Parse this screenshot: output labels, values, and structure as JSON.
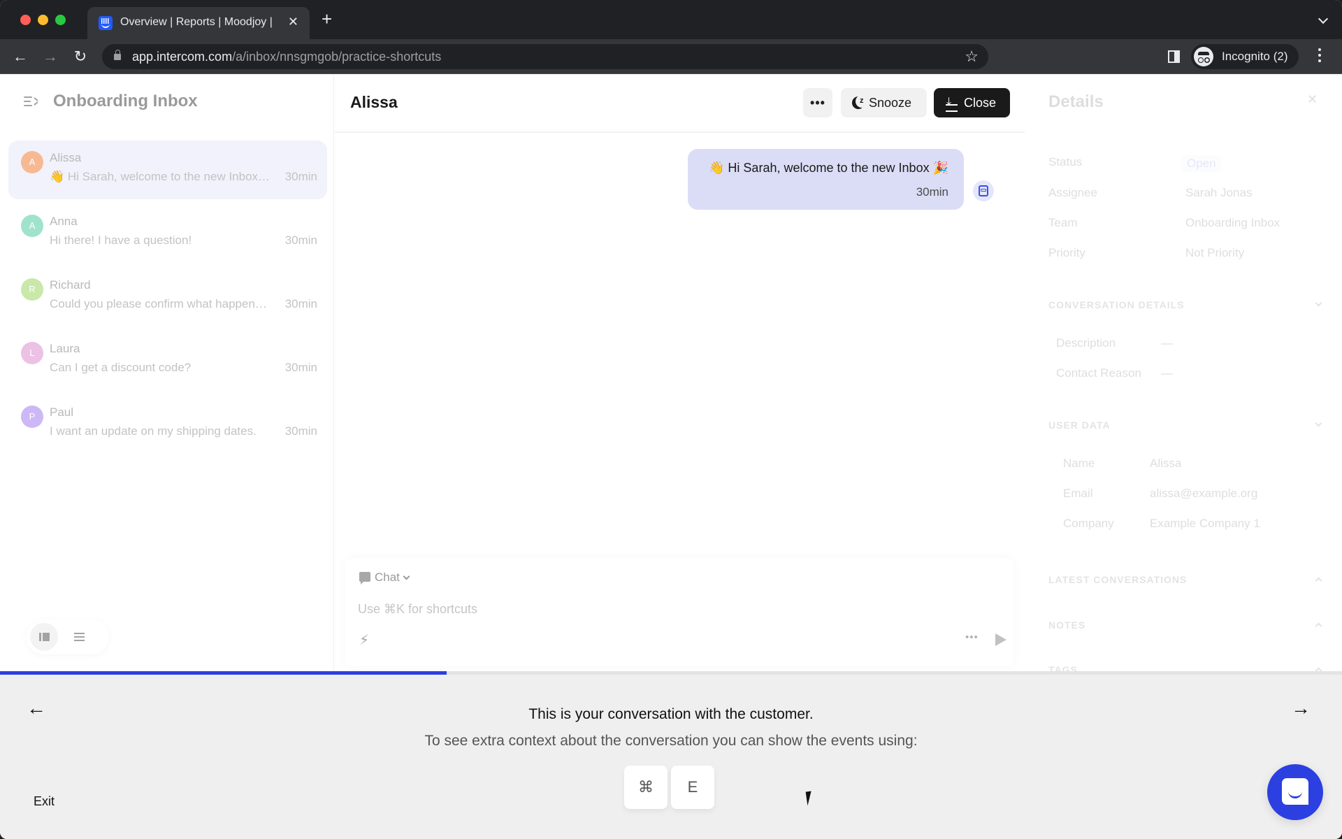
{
  "browser": {
    "tab_title": "Overview | Reports | Moodjoy |",
    "url_host": "app.intercom.com",
    "url_path": "/a/inbox/nnsgmgob/practice-shortcuts",
    "profile_label": "Incognito (2)"
  },
  "inbox": {
    "title": "Onboarding Inbox",
    "conversations": [
      {
        "initial": "A",
        "name": "Alissa",
        "preview": "👋 Hi Sarah, welcome to the new Inbox 🎉",
        "time": "30min",
        "color": "#f7b993",
        "selected": true
      },
      {
        "initial": "A",
        "name": "Anna",
        "preview": "Hi there! I have a question!",
        "time": "30min",
        "color": "#9fe3cc",
        "selected": false
      },
      {
        "initial": "R",
        "name": "Richard",
        "preview": "Could you please confirm what happened with my order?",
        "time": "30min",
        "color": "#c9e8a9",
        "selected": false
      },
      {
        "initial": "L",
        "name": "Laura",
        "preview": "Can I get a discount code?",
        "time": "30min",
        "color": "#ebc1e4",
        "selected": false
      },
      {
        "initial": "P",
        "name": "Paul",
        "preview": "I want an update on my shipping dates.",
        "time": "30min",
        "color": "#cdb8f6",
        "selected": false
      }
    ]
  },
  "conversation": {
    "title": "Alissa",
    "more_label": "•••",
    "snooze_label": "Snooze",
    "close_label": "Close",
    "message": {
      "text": "👋 Hi Sarah, welcome to the new Inbox 🎉",
      "time": "30min"
    },
    "composer": {
      "mode": "Chat",
      "placeholder": "Use ⌘K for shortcuts",
      "more_label": "•••"
    }
  },
  "details": {
    "title": "Details",
    "close_label": "✕",
    "fields": [
      {
        "label": "Status",
        "value": "Open"
      },
      {
        "label": "Assignee",
        "value": "Sarah Jonas"
      },
      {
        "label": "Team",
        "value": "Onboarding Inbox"
      },
      {
        "label": "Priority",
        "value": "Not Priority"
      }
    ],
    "conversation_details": {
      "heading": "CONVERSATION DETAILS",
      "fields": [
        {
          "label": "Description",
          "value": "—"
        },
        {
          "label": "Contact Reason",
          "value": "—"
        }
      ]
    },
    "user_data": {
      "heading": "USER DATA",
      "fields": [
        {
          "label": "Name",
          "value": "Alissa"
        },
        {
          "label": "Email",
          "value": "alissa@example.org"
        },
        {
          "label": "Company",
          "value": "Example Company 1"
        }
      ]
    },
    "sections": [
      "LATEST CONVERSATIONS",
      "NOTES",
      "TAGS"
    ]
  },
  "tour": {
    "progress_percent": 33.3,
    "title": "This is your conversation with the customer.",
    "subtitle": "To see extra context about the conversation you can show the events using:",
    "keys": [
      "⌘",
      "E"
    ],
    "exit_label": "Exit",
    "accent": "#2c3fe0"
  }
}
